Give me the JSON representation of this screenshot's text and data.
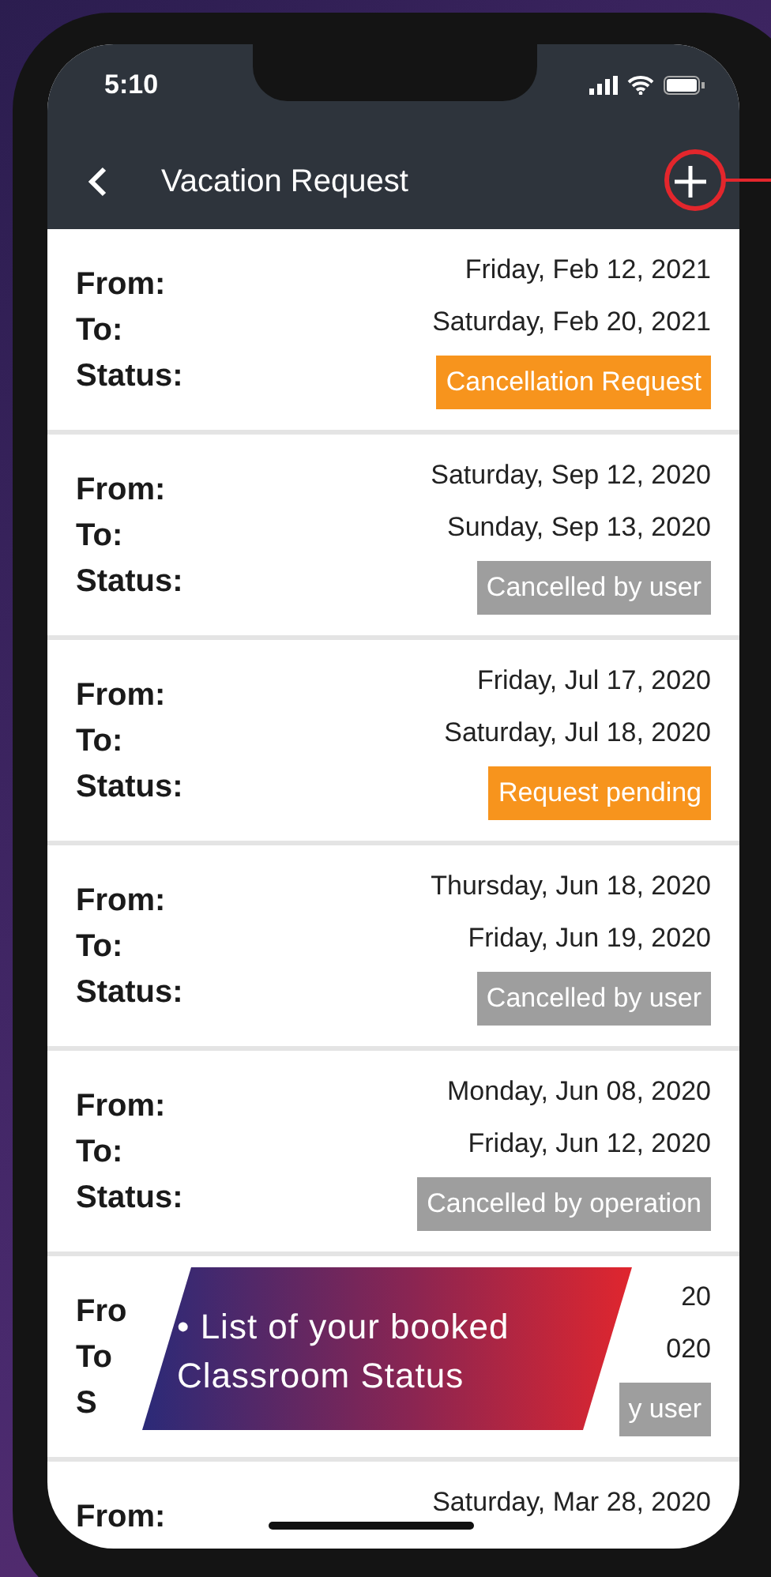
{
  "status_bar": {
    "time": "5:10"
  },
  "nav_bar": {
    "title": "Vacation Request"
  },
  "requests": [
    {
      "from_label": "From:",
      "to_label": "To:",
      "status_label": "Status:",
      "from": "Friday, Feb 12, 2021",
      "to": "Saturday, Feb 20, 2021",
      "status": "Cancellation Request",
      "color": "#f7941d"
    },
    {
      "from_label": "From:",
      "to_label": "To:",
      "status_label": "Status:",
      "from": "Saturday, Sep 12, 2020",
      "to": "Sunday, Sep 13, 2020",
      "status": "Cancelled by user",
      "color": "#9e9e9e"
    },
    {
      "from_label": "From:",
      "to_label": "To:",
      "status_label": "Status:",
      "from": "Friday, Jul 17, 2020",
      "to": "Saturday, Jul 18, 2020",
      "status": "Request pending",
      "color": "#f7941d"
    },
    {
      "from_label": "From:",
      "to_label": "To:",
      "status_label": "Status:",
      "from": "Thursday, Jun 18, 2020",
      "to": "Friday, Jun 19, 2020",
      "status": "Cancelled by user",
      "color": "#9e9e9e"
    },
    {
      "from_label": "From:",
      "to_label": "To:",
      "status_label": "Status:",
      "from": "Monday, Jun 08, 2020",
      "to": "Friday, Jun 12, 2020",
      "status": "Cancelled by operation",
      "color": "#9e9e9e"
    },
    {
      "from_label": "Fro",
      "to_label": "To",
      "status_label": "S",
      "from": "20",
      "to": "020",
      "status": "y user",
      "color": "#9e9e9e"
    },
    {
      "from_label": "From:",
      "from": "Saturday, Mar 28, 2020"
    }
  ],
  "callout": {
    "lines": [
      "• List of your booked",
      "Classroom Status"
    ]
  }
}
